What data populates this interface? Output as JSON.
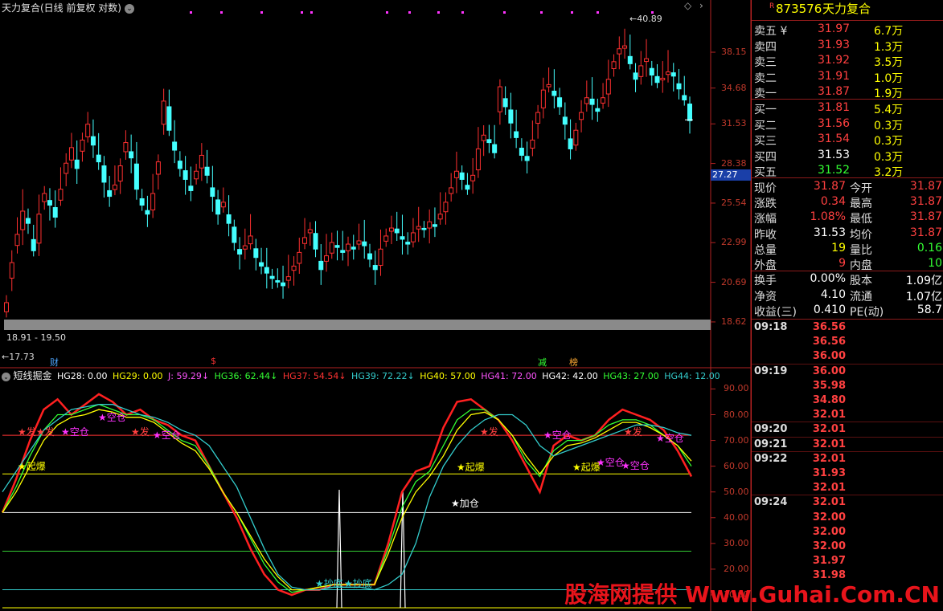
{
  "title": "天力复合(日线 前复权 对数)",
  "indicator_title": "短线掘金",
  "indicator_values": [
    {
      "text": "HG28: 0.00",
      "color": "#ffffff"
    },
    {
      "text": "HG29: 0.00",
      "color": "#ffff00"
    },
    {
      "text": "J: 59.29↓",
      "color": "#ff55ff"
    },
    {
      "text": "HG36: 62.44↓",
      "color": "#33ff33"
    },
    {
      "text": "HG37: 54.54↓",
      "color": "#ff3333"
    },
    {
      "text": "HG39: 72.22↓",
      "color": "#33cccc"
    },
    {
      "text": "HG40: 57.00",
      "color": "#ffff00"
    },
    {
      "text": "HG41: 72.00",
      "color": "#ff55ff"
    },
    {
      "text": "HG42: 42.00",
      "color": "#ffffff"
    },
    {
      "text": "HG43: 27.00",
      "color": "#33ff33"
    },
    {
      "text": "HG44: 12.00",
      "color": "#33cccc"
    }
  ],
  "price_axis": [
    "38.15",
    "34.68",
    "31.53",
    "28.38",
    "25.54",
    "22.99",
    "20.69",
    "18.62"
  ],
  "current_price_tag": "27.27",
  "high_annotation": "40.89",
  "low_annotation": "17.73",
  "range_label": "18.91 - 19.50",
  "event_markers": [
    {
      "text": "财",
      "color": "#4da6ff"
    },
    {
      "text": "$",
      "color": "#ff3333"
    },
    {
      "text": "减",
      "color": "#33ff33"
    },
    {
      "text": "榜",
      "color": "#ffaa33"
    }
  ],
  "indicator_axis": [
    "90.00",
    "80.00",
    "70.00",
    "60.00",
    "50.00",
    "40.00",
    "30.00",
    "20.00",
    "10.00"
  ],
  "signal_labels": {
    "qibao": "起爆",
    "kongcang": "空仓",
    "fa": "发",
    "jiacang": "加仓",
    "chaodi": "抄底"
  },
  "quote": {
    "flag": "R",
    "code": "873576",
    "name": "天力复合",
    "asks": [
      {
        "label": "卖五 ¥",
        "price": "31.97",
        "vol": "6.7万"
      },
      {
        "label": "卖四",
        "price": "31.93",
        "vol": "1.3万"
      },
      {
        "label": "卖三",
        "price": "31.92",
        "vol": "3.5万"
      },
      {
        "label": "卖二",
        "price": "31.91",
        "vol": "1.0万"
      },
      {
        "label": "卖一",
        "price": "31.87",
        "vol": "1.9万"
      }
    ],
    "bids": [
      {
        "label": "买一",
        "price": "31.81",
        "vol": "5.4万",
        "pc": "#ff4040"
      },
      {
        "label": "买二",
        "price": "31.56",
        "vol": "0.3万",
        "pc": "#ff4040"
      },
      {
        "label": "买三",
        "price": "31.54",
        "vol": "0.3万",
        "pc": "#ff4040"
      },
      {
        "label": "买四",
        "price": "31.53",
        "vol": "0.3万",
        "pc": "#ffffff"
      },
      {
        "label": "买五",
        "price": "31.52",
        "vol": "3.2万",
        "pc": "#33ff33"
      }
    ],
    "stats": [
      {
        "l1": "现价",
        "v1": "31.87",
        "c1": "#ff4040",
        "l2": "今开",
        "v2": "31.87",
        "c2": "#ff4040"
      },
      {
        "l1": "涨跌",
        "v1": "0.34",
        "c1": "#ff4040",
        "l2": "最高",
        "v2": "31.87",
        "c2": "#ff4040"
      },
      {
        "l1": "涨幅",
        "v1": "1.08%",
        "c1": "#ff4040",
        "l2": "最低",
        "v2": "31.87",
        "c2": "#ff4040"
      },
      {
        "l1": "昨收",
        "v1": "31.53",
        "c1": "#ffffff",
        "l2": "均价",
        "v2": "31.87",
        "c2": "#ff4040"
      },
      {
        "l1": "总量",
        "v1": "19",
        "c1": "#ffff00",
        "l2": "量比",
        "v2": "0.16",
        "c2": "#33ff33"
      },
      {
        "l1": "外盘",
        "v1": "9",
        "c1": "#ff4040",
        "l2": "内盘",
        "v2": "10",
        "c2": "#33ff33"
      }
    ],
    "fund": [
      {
        "l1": "换手",
        "v1": "0.00%",
        "l2": "股本",
        "v2": "1.09亿"
      },
      {
        "l1": "净资",
        "v1": "4.10",
        "l2": "流通",
        "v2": "1.07亿"
      },
      {
        "l1": "收益(三)",
        "v1": "0.410",
        "l2": "PE(动)",
        "v2": "58.7"
      }
    ],
    "ticks": [
      {
        "t": "09:18",
        "p": "36.56",
        "c": "#ff4040"
      },
      {
        "t": "",
        "p": "36.56",
        "c": "#ff4040"
      },
      {
        "t": "",
        "p": "36.00",
        "c": "#ff4040"
      },
      {
        "t": "09:19",
        "p": "36.00",
        "c": "#ff4040"
      },
      {
        "t": "",
        "p": "35.98",
        "c": "#ff4040"
      },
      {
        "t": "",
        "p": "34.80",
        "c": "#ff4040"
      },
      {
        "t": "",
        "p": "32.01",
        "c": "#ff4040"
      },
      {
        "t": "09:20",
        "p": "32.01",
        "c": "#ff4040"
      },
      {
        "t": "09:21",
        "p": "32.01",
        "c": "#ff4040"
      },
      {
        "t": "09:22",
        "p": "32.01",
        "c": "#ff4040"
      },
      {
        "t": "",
        "p": "31.93",
        "c": "#ff4040"
      },
      {
        "t": "",
        "p": "32.01",
        "c": "#ff4040"
      },
      {
        "t": "09:24",
        "p": "32.01",
        "c": "#ff4040"
      },
      {
        "t": "",
        "p": "32.00",
        "c": "#ff4040"
      },
      {
        "t": "",
        "p": "32.00",
        "c": "#ff4040"
      },
      {
        "t": "",
        "p": "32.00",
        "c": "#ff4040"
      },
      {
        "t": "",
        "p": "31.97",
        "c": "#ff4040"
      },
      {
        "t": "",
        "p": "31.98",
        "c": "#ff4040"
      }
    ]
  },
  "watermark": "股海网提供 Www.Guhai.Com.CN",
  "chart_data": {
    "type": "candlestick",
    "closes": [
      19.6,
      21.8,
      23.5,
      25.0,
      24.2,
      22.5,
      24.8,
      26.2,
      25.4,
      24.6,
      26.5,
      28.4,
      29.6,
      28.0,
      30.2,
      31.5,
      29.8,
      28.5,
      27.0,
      26.0,
      26.8,
      28.2,
      30.0,
      28.8,
      26.5,
      25.4,
      24.8,
      26.2,
      28.5,
      33.5,
      31.0,
      29.4,
      28.0,
      27.2,
      26.4,
      27.8,
      29.0,
      27.5,
      26.0,
      24.8,
      25.6,
      24.2,
      23.0,
      22.3,
      22.8,
      23.4,
      22.1,
      21.6,
      21.2,
      20.9,
      20.7,
      20.5,
      21.0,
      21.6,
      22.4,
      23.3,
      23.8,
      22.6,
      21.4,
      22.2,
      23.0,
      22.7,
      22.4,
      22.9,
      22.6,
      23.1,
      22.8,
      22.0,
      21.4,
      22.6,
      23.4,
      23.9,
      23.6,
      23.2,
      22.9,
      23.6,
      24.0,
      23.8,
      24.3,
      24.0,
      24.8,
      25.6,
      26.6,
      27.8,
      27.2,
      26.5,
      27.5,
      29.5,
      30.6,
      30.0,
      29.2,
      34.8,
      33.0,
      31.6,
      30.4,
      29.0,
      28.6,
      30.2,
      32.5,
      34.5,
      35.0,
      34.0,
      33.0,
      31.5,
      29.5,
      31.0,
      32.5,
      33.8,
      33.2,
      32.6,
      33.8,
      35.5,
      37.2,
      38.5,
      38.8,
      37.0,
      35.5,
      36.8,
      37.5,
      35.9,
      35.2,
      35.6,
      36.2,
      35.8,
      34.6,
      33.6,
      31.8
    ],
    "price_ticks": [
      38.15,
      34.68,
      31.53,
      28.38,
      25.54,
      22.99,
      20.69,
      18.62
    ],
    "y_log": true,
    "indicator_ticks": [
      90,
      80,
      70,
      60,
      50,
      40,
      30,
      20,
      10
    ],
    "indicator_levels": [
      72,
      57,
      42,
      27,
      12
    ],
    "series": [
      {
        "name": "HG37",
        "color": "#ff2020",
        "values": [
          42,
          55,
          70,
          82,
          86,
          80,
          84,
          88,
          85,
          80,
          82,
          78,
          76,
          72,
          70,
          60,
          50,
          40,
          28,
          18,
          12,
          10,
          12,
          12,
          14,
          14,
          14,
          14,
          30,
          50,
          58,
          60,
          75,
          85,
          86,
          82,
          78,
          70,
          60,
          50,
          68,
          72,
          70,
          72,
          78,
          82,
          80,
          78,
          74,
          66,
          56
        ]
      },
      {
        "name": "HG36",
        "color": "#33ff33",
        "values": [
          42,
          52,
          64,
          74,
          80,
          80,
          82,
          84,
          82,
          80,
          80,
          78,
          74,
          70,
          68,
          60,
          50,
          42,
          32,
          22,
          15,
          11,
          12,
          13,
          14,
          14,
          14,
          14,
          28,
          44,
          54,
          58,
          68,
          78,
          82,
          82,
          78,
          72,
          62,
          56,
          66,
          70,
          70,
          72,
          76,
          78,
          78,
          76,
          72,
          68,
          60
        ]
      },
      {
        "name": "HG40",
        "color": "#ffff00",
        "values": [
          42,
          50,
          60,
          70,
          76,
          79,
          80,
          82,
          81,
          79,
          79,
          77,
          73,
          69,
          66,
          59,
          50,
          42,
          33,
          24,
          17,
          12,
          12,
          13,
          14,
          14,
          14,
          14,
          26,
          40,
          50,
          56,
          64,
          74,
          80,
          81,
          78,
          72,
          64,
          57,
          64,
          68,
          69,
          71,
          74,
          77,
          77,
          75,
          72,
          68,
          62
        ]
      },
      {
        "name": "HG39",
        "color": "#33cccc",
        "values": [
          50,
          58,
          66,
          74,
          78,
          82,
          83,
          84,
          84,
          82,
          80,
          79,
          77,
          74,
          72,
          68,
          60,
          52,
          40,
          28,
          18,
          13,
          12,
          12,
          13,
          13,
          13,
          12,
          14,
          18,
          30,
          48,
          60,
          68,
          74,
          78,
          80,
          80,
          76,
          68,
          64,
          66,
          68,
          70,
          72,
          74,
          76,
          76,
          75,
          73,
          72
        ]
      }
    ]
  }
}
